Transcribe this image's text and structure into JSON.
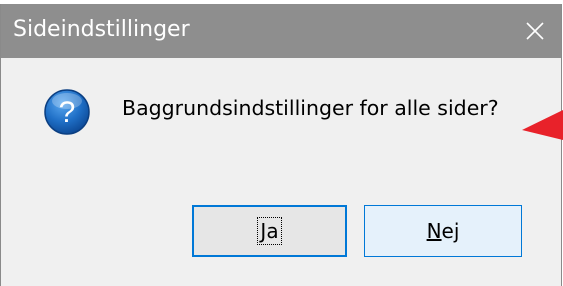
{
  "window": {
    "title": "Sideindstillinger",
    "close_glyph": "✕"
  },
  "dialog": {
    "icon": "question-icon",
    "message": "Baggrundsindstillinger for alle sider?"
  },
  "buttons": {
    "yes": {
      "mnemonic": "J",
      "rest": "a"
    },
    "no": {
      "mnemonic": "N",
      "rest": "ej"
    }
  },
  "colors": {
    "titlebar": "#8e8e8e",
    "accent": "#0078d7",
    "annotation_arrow": "#e8222a"
  }
}
